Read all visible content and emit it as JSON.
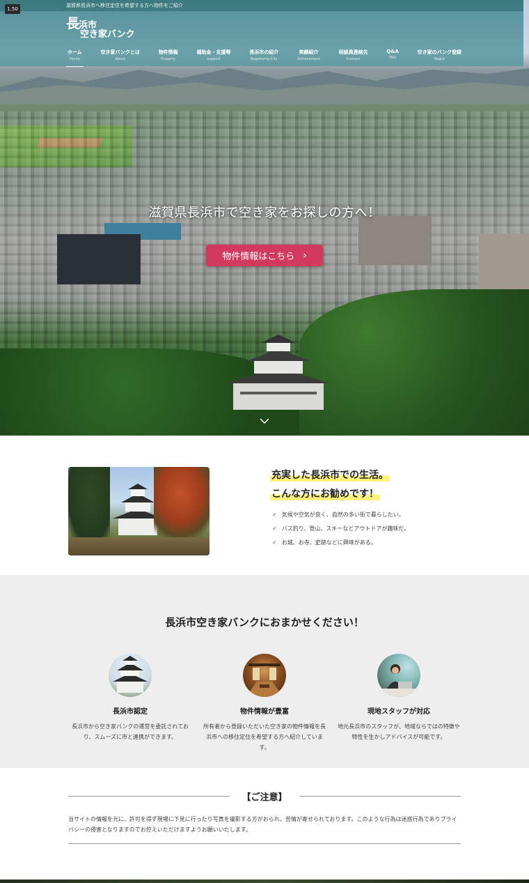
{
  "zoom_badge": "1.50",
  "header": {
    "tagline": "滋賀県長浜市へ移住定住を希望する方へ物件をご紹介",
    "logo_line1a": "長",
    "logo_line1b": "浜市",
    "logo_line2": "空き家バンク"
  },
  "nav": {
    "items": [
      {
        "label": "ホーム",
        "sub": "Home"
      },
      {
        "label": "空き家バンクとは",
        "sub": "About"
      },
      {
        "label": "物件情報",
        "sub": "Property"
      },
      {
        "label": "補助金・支援等",
        "sub": "support"
      },
      {
        "label": "長浜市の紹介",
        "sub": "Nagahama-City"
      },
      {
        "label": "実績紹介",
        "sub": "Achievement"
      },
      {
        "label": "相談員連絡先",
        "sub": "Contact"
      },
      {
        "label": "Q&A",
        "sub": "FAQ"
      },
      {
        "label": "空き家のバンク登録",
        "sub": "Regist"
      }
    ],
    "active_index": 0
  },
  "hero": {
    "title": "滋賀県長浜市で空き家をお探しの方へ！",
    "button_label": "物件情報はこちら",
    "button_color": "#d13a5e"
  },
  "intro": {
    "heading_line1": "充実した長浜市での生活。",
    "heading_line2": "こんな方にお勧めです！",
    "checklist": [
      "気候や空気が良く、自然の多い街で暮らしたい。",
      "バス釣り、登山、スキーなどアウトドアが趣味だ。",
      "お城、お寺、史跡などに興味がある。"
    ],
    "highlight_color": "#fff27a",
    "check_color": "#d0263e"
  },
  "service": {
    "title": "長浜市空き家バンクにおまかせください！",
    "features": [
      {
        "title": "長浜市認定",
        "desc": "長浜市から空き家バンクの運営を委託されており、スムーズに市と連携ができます。"
      },
      {
        "title": "物件情報が豊富",
        "desc": "所有者から登録いただいた空き家の物件情報を長浜市への移住定住を希望する方へ紹介しています。"
      },
      {
        "title": "現地スタッフが対応",
        "desc": "地元長浜市のスタッフが、地域ならではの特徴や特性を生かしアドバイスが可能です。"
      }
    ]
  },
  "notice": {
    "title": "【ご注意】",
    "text": "当サイトの情報を元に、許可を得ず現場に下見に行ったり写真を撮影する方がおられ、苦情が寄せられております。このような行為は迷惑行為でありプライバシーの侵害となりますのでお控えいただけますようお願いいたします。"
  }
}
